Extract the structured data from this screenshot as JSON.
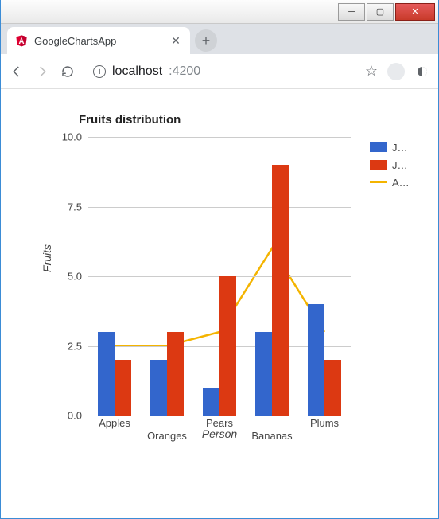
{
  "window": {
    "min": "─",
    "max": "▢",
    "close": "✕"
  },
  "browser": {
    "tab_title": "GoogleChartsApp",
    "tab_close": "✕",
    "newtab": "+",
    "url_host": "localhost",
    "url_port": ":4200",
    "back": "←",
    "forward": "→",
    "reload": "↻",
    "info": "i",
    "star": "☆",
    "menu": "◑"
  },
  "chart_data": {
    "type": "bar+line",
    "title": "Fruits distribution",
    "xlabel": "Person",
    "ylabel": "Fruits",
    "categories": [
      "Apples",
      "Oranges",
      "Pears",
      "Bananas",
      "Plums"
    ],
    "ylim": [
      0,
      10
    ],
    "yticks": [
      0.0,
      2.5,
      5.0,
      7.5,
      10.0
    ],
    "series": [
      {
        "name": "J…",
        "type": "bar",
        "color": "#3366cc",
        "values": [
          3,
          2,
          1,
          3,
          4
        ]
      },
      {
        "name": "J…",
        "type": "bar",
        "color": "#dc3912",
        "values": [
          2,
          3,
          5,
          9,
          2
        ]
      },
      {
        "name": "A…",
        "type": "line",
        "color": "#f4b400",
        "values": [
          2.5,
          2.5,
          3,
          6,
          3
        ]
      }
    ],
    "legend_position": "right"
  }
}
